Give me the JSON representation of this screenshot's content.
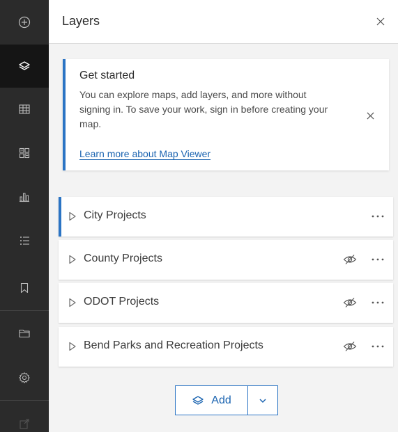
{
  "rail": {
    "items": [
      {
        "name": "add-circle-icon"
      },
      {
        "name": "layers-icon",
        "active": true
      },
      {
        "name": "table-icon"
      },
      {
        "name": "basemap-icon"
      },
      {
        "name": "charts-icon"
      },
      {
        "name": "legend-icon"
      },
      {
        "name": "bookmark-icon"
      },
      {
        "name": "folder-icon"
      },
      {
        "name": "gear-icon"
      },
      {
        "name": "share-icon"
      }
    ]
  },
  "panel": {
    "title": "Layers"
  },
  "notice": {
    "title": "Get started",
    "body": "You can explore maps, add layers, and more without signing in. To save your work, sign in before creating your map.",
    "link": "Learn more about Map Viewer"
  },
  "layers": [
    {
      "name": "City Projects",
      "visibility_icon": false,
      "selected": true
    },
    {
      "name": "County Projects",
      "visibility_icon": true,
      "selected": false
    },
    {
      "name": "ODOT Projects",
      "visibility_icon": true,
      "selected": false
    },
    {
      "name": "Bend Parks and Recreation Projects",
      "visibility_icon": true,
      "selected": false
    }
  ],
  "add_button": {
    "label": "Add"
  },
  "colors": {
    "accent": "#2b74c4",
    "rail_bg": "#2b2b2b",
    "rail_active": "#151515"
  }
}
